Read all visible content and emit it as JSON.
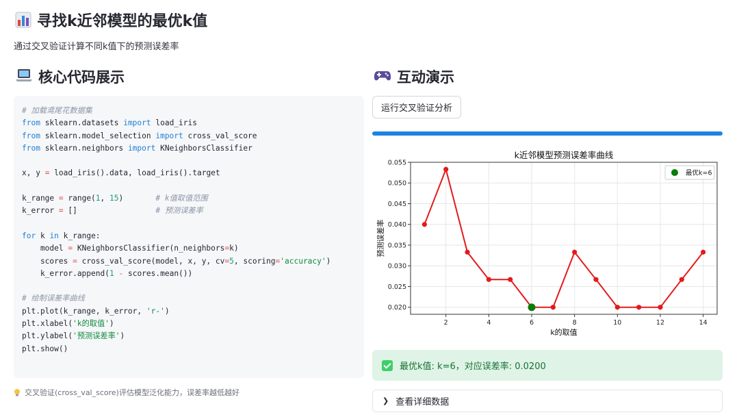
{
  "header": {
    "title": "寻找k近邻模型的最优k值",
    "subtitle": "通过交叉验证计算不同k值下的预测误差率"
  },
  "left": {
    "section_title": "核心代码展示",
    "code_lines": [
      [
        {
          "t": "# 加载鸢尾花数据集",
          "c": "cm"
        }
      ],
      [
        {
          "t": "from",
          "c": "kw"
        },
        {
          "t": " sklearn.datasets "
        },
        {
          "t": "import",
          "c": "kw"
        },
        {
          "t": " load_iris"
        }
      ],
      [
        {
          "t": "from",
          "c": "kw"
        },
        {
          "t": " sklearn.model_selection "
        },
        {
          "t": "import",
          "c": "kw"
        },
        {
          "t": " cross_val_score"
        }
      ],
      [
        {
          "t": "from",
          "c": "kw"
        },
        {
          "t": " sklearn.neighbors "
        },
        {
          "t": "import",
          "c": "kw"
        },
        {
          "t": " KNeighborsClassifier"
        }
      ],
      [],
      [
        {
          "t": "x, y "
        },
        {
          "t": "=",
          "c": "op"
        },
        {
          "t": " load_iris().data, load_iris().target"
        }
      ],
      [],
      [
        {
          "t": "k_range "
        },
        {
          "t": "=",
          "c": "op"
        },
        {
          "t": " range("
        },
        {
          "t": "1",
          "c": "num"
        },
        {
          "t": ", "
        },
        {
          "t": "15",
          "c": "num"
        },
        {
          "t": ")       "
        },
        {
          "t": "# k值取值范围",
          "c": "cm"
        }
      ],
      [
        {
          "t": "k_error "
        },
        {
          "t": "=",
          "c": "op"
        },
        {
          "t": " []                 "
        },
        {
          "t": "# 预测误差率",
          "c": "cm"
        }
      ],
      [],
      [
        {
          "t": "for",
          "c": "kw"
        },
        {
          "t": " k "
        },
        {
          "t": "in",
          "c": "kw"
        },
        {
          "t": " k_range:"
        }
      ],
      [
        {
          "t": "    model "
        },
        {
          "t": "=",
          "c": "op"
        },
        {
          "t": " KNeighborsClassifier(n_neighbors"
        },
        {
          "t": "=",
          "c": "op"
        },
        {
          "t": "k)"
        }
      ],
      [
        {
          "t": "    scores "
        },
        {
          "t": "=",
          "c": "op"
        },
        {
          "t": " cross_val_score(model, x, y, cv"
        },
        {
          "t": "=",
          "c": "op"
        },
        {
          "t": "5",
          "c": "num"
        },
        {
          "t": ", scoring"
        },
        {
          "t": "=",
          "c": "op"
        },
        {
          "t": "'accuracy'",
          "c": "str"
        },
        {
          "t": ")"
        }
      ],
      [
        {
          "t": "    k_error.append("
        },
        {
          "t": "1",
          "c": "num"
        },
        {
          "t": " "
        },
        {
          "t": "-",
          "c": "op"
        },
        {
          "t": " scores.mean())"
        }
      ],
      [],
      [
        {
          "t": "# 绘制误差率曲线",
          "c": "cm"
        }
      ],
      [
        {
          "t": "plt.plot(k_range, k_error, "
        },
        {
          "t": "'r-'",
          "c": "str"
        },
        {
          "t": ")"
        }
      ],
      [
        {
          "t": "plt.xlabel("
        },
        {
          "t": "'k的取值'",
          "c": "str"
        },
        {
          "t": ")"
        }
      ],
      [
        {
          "t": "plt.ylabel("
        },
        {
          "t": "'预测误差率'",
          "c": "str"
        },
        {
          "t": ")"
        }
      ],
      [
        {
          "t": "plt.show()"
        }
      ]
    ],
    "tip": "交叉验证(cross_val_score)评估模型泛化能力，误差率越低越好"
  },
  "right": {
    "section_title": "互动演示",
    "run_button_label": "运行交叉验证分析",
    "progress": 1.0,
    "success_text": "最优k值: k=6，对应误差率: 0.0200",
    "expander_label": "查看详细数据"
  },
  "colors": {
    "accent": "#1c83e1",
    "line": "#e31a1c",
    "best_point": "#0a7d0a",
    "success_bg": "#dff3e6",
    "success_text": "#177233"
  },
  "chart_data": {
    "type": "line",
    "title": "k近邻模型预测误差率曲线",
    "xlabel": "k的取值",
    "ylabel": "预测误差率",
    "x": [
      1,
      2,
      3,
      4,
      5,
      6,
      7,
      8,
      9,
      10,
      11,
      12,
      13,
      14
    ],
    "y": [
      0.04,
      0.0533,
      0.0333,
      0.0267,
      0.0267,
      0.02,
      0.02,
      0.0333,
      0.0267,
      0.02,
      0.02,
      0.02,
      0.0267,
      0.0333
    ],
    "xticks": [
      2,
      4,
      6,
      8,
      10,
      12,
      14
    ],
    "yticks": [
      0.02,
      0.025,
      0.03,
      0.035,
      0.04,
      0.045,
      0.05,
      0.055
    ],
    "ytick_labels": [
      "0.020",
      "0.025",
      "0.030",
      "0.035",
      "0.040",
      "0.045",
      "0.050",
      "0.055"
    ],
    "xlim": [
      0.35,
      14.65
    ],
    "ylim": [
      0.0183,
      0.055
    ],
    "grid": true,
    "legend": {
      "label": "最优k=6",
      "placement": "top-right"
    },
    "best_point": {
      "x": 6,
      "y": 0.02
    }
  }
}
